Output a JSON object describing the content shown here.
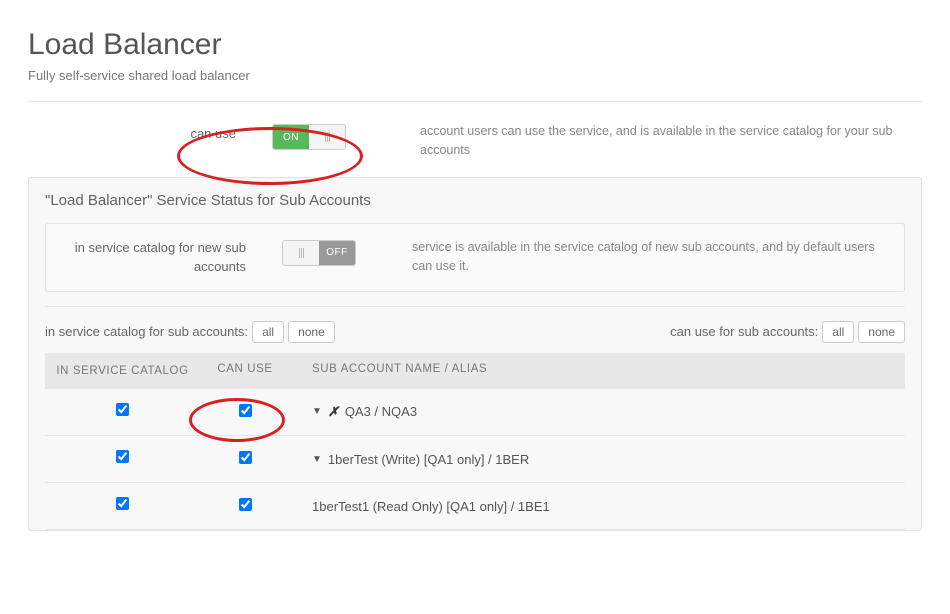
{
  "page": {
    "title": "Load Balancer",
    "subtitle": "Fully self-service shared load balancer"
  },
  "can_use": {
    "label": "can use",
    "toggle_on_text": "ON",
    "state": "on",
    "description": "account users can use the service, and is available in the service catalog for your sub accounts"
  },
  "panel": {
    "title": "\"Load Balancer\" Service Status for Sub Accounts",
    "new_sub": {
      "label": "in service catalog for new sub accounts",
      "toggle_off_text": "OFF",
      "state": "off",
      "description": "service is available in the service catalog of new sub accounts, and by default users can use it."
    },
    "filters": {
      "left_label": "in service catalog for sub accounts:",
      "right_label": "can use for sub accounts:",
      "all": "all",
      "none": "none"
    },
    "columns": {
      "c1": "IN SERVICE CATALOG",
      "c2": "CAN USE",
      "c3": "SUB ACCOUNT NAME / ALIAS"
    },
    "rows": [
      {
        "in_catalog": true,
        "can_use": true,
        "has_caret": true,
        "has_x": true,
        "name": "QA3 / NQA3"
      },
      {
        "in_catalog": true,
        "can_use": true,
        "has_caret": true,
        "has_x": false,
        "name": "1berTest (Write) [QA1 only] / 1BER"
      },
      {
        "in_catalog": true,
        "can_use": true,
        "has_caret": false,
        "has_x": false,
        "name": "1berTest1 (Read Only) [QA1 only] / 1BE1"
      }
    ]
  }
}
